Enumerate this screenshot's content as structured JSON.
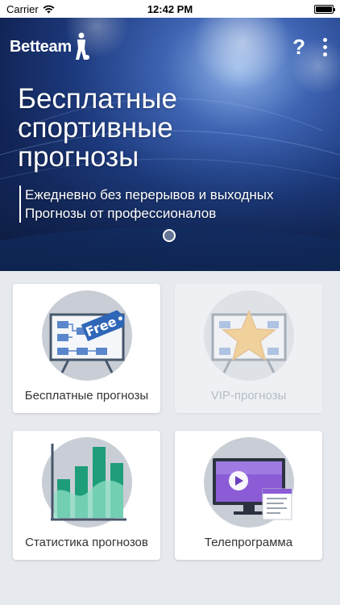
{
  "status_bar": {
    "carrier": "Carrier",
    "time": "12:42 PM",
    "battery_level": 1.0
  },
  "header": {
    "logo_text": "Betteam",
    "help_label": "?"
  },
  "hero": {
    "title": "Бесплатные спортивные прогнозы",
    "features": [
      "Ежедневно без перерывов и выходных",
      "Прогнозы от профессионалов"
    ],
    "page_count": 1,
    "active_page": 1
  },
  "cards": [
    {
      "label": "Бесплатные прогнозы",
      "icon": "free-board-icon",
      "enabled": true,
      "badge": "Free"
    },
    {
      "label": "VIP-прогнозы",
      "icon": "vip-star-icon",
      "enabled": false
    },
    {
      "label": "Статистика прогнозов",
      "icon": "stats-chart-icon",
      "enabled": true
    },
    {
      "label": "Телепрограмма",
      "icon": "tv-program-icon",
      "enabled": true
    }
  ],
  "colors": {
    "accent_blue": "#2f66b8",
    "hero_dark": "#0f1f4d",
    "chart_green": "#1e9d7a",
    "tv_purple": "#8b5cd6"
  }
}
